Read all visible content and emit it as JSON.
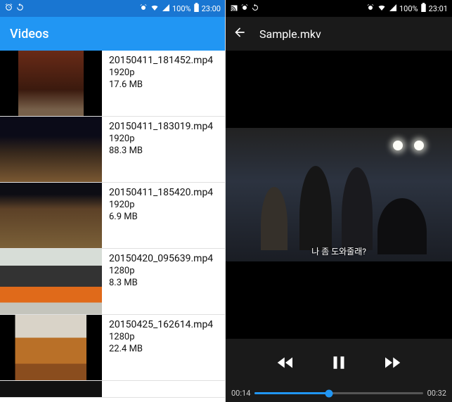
{
  "left": {
    "status": {
      "battery_pct": "100%",
      "time": "23:00"
    },
    "appbar_title": "Videos",
    "videos": [
      {
        "filename": "20150411_181452.mp4",
        "resolution": "1920p",
        "size": "17.6 MB"
      },
      {
        "filename": "20150411_183019.mp4",
        "resolution": "1920p",
        "size": "88.3 MB"
      },
      {
        "filename": "20150411_185420.mp4",
        "resolution": "1920p",
        "size": "6.9 MB"
      },
      {
        "filename": "20150420_095639.mp4",
        "resolution": "1280p",
        "size": "8.3 MB"
      },
      {
        "filename": "20150425_162614.mp4",
        "resolution": "1280p",
        "size": "22.4 MB"
      }
    ]
  },
  "right": {
    "status": {
      "battery_pct": "100%",
      "time": "23:01"
    },
    "title": "Sample.mkv",
    "subtitle": "나 좀 도와줄래?",
    "progress": {
      "current": "00:14",
      "total": "00:32",
      "percent": 44
    },
    "colors": {
      "accent": "#2196f3"
    }
  }
}
